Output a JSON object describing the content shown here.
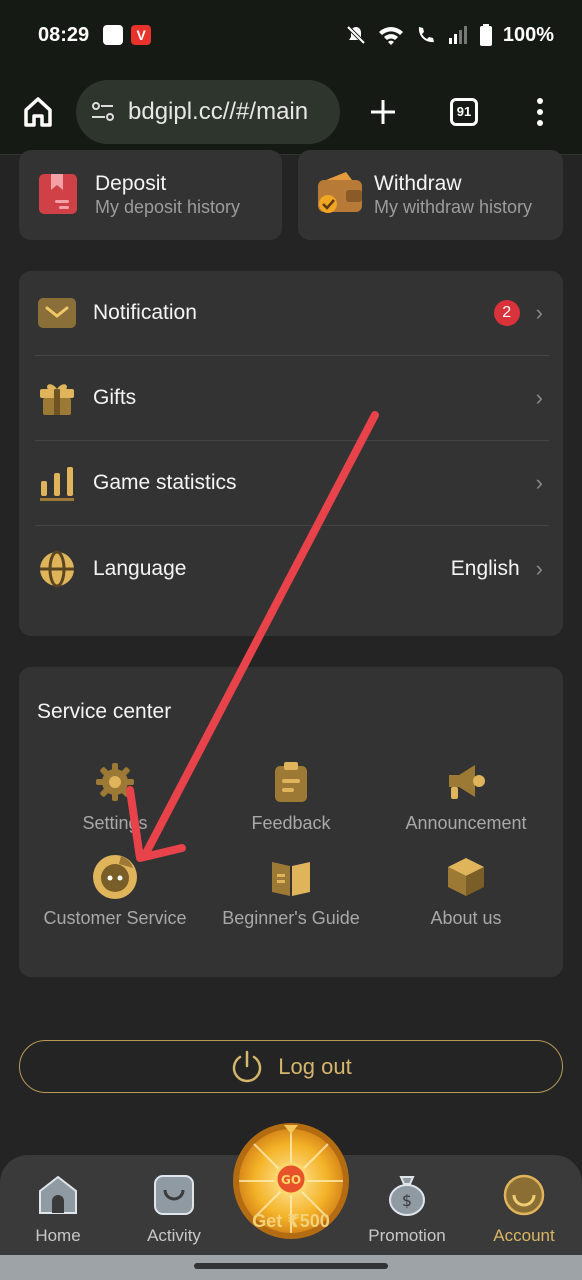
{
  "status_bar": {
    "time": "08:29",
    "battery": "100%",
    "app_icon_v": "V"
  },
  "browser": {
    "url": "bdgipl.cc//#/main",
    "tab_count": "91"
  },
  "wallet_cards": {
    "deposit": {
      "title": "Deposit",
      "subtitle": "My deposit history"
    },
    "withdraw": {
      "title": "Withdraw",
      "subtitle": "My withdraw history"
    }
  },
  "menu": {
    "notification": {
      "label": "Notification",
      "badge": "2"
    },
    "gifts": {
      "label": "Gifts"
    },
    "game_statistics": {
      "label": "Game statistics"
    },
    "language": {
      "label": "Language",
      "value": "English"
    }
  },
  "service_center": {
    "title": "Service center",
    "items": [
      {
        "label": "Settings",
        "icon": "gear-icon"
      },
      {
        "label": "Feedback",
        "icon": "clipboard-icon"
      },
      {
        "label": "Announcement",
        "icon": "megaphone-icon"
      },
      {
        "label": "Customer Service",
        "icon": "chat-bubble-icon"
      },
      {
        "label": "Beginner's Guide",
        "icon": "book-icon"
      },
      {
        "label": "About us",
        "icon": "box-icon"
      }
    ]
  },
  "logout": {
    "label": "Log out"
  },
  "bottom_nav": {
    "home": "Home",
    "activity": "Activity",
    "spin": {
      "go": "GO",
      "label": "Get ₹500"
    },
    "promotion": "Promotion",
    "account": "Account"
  },
  "colors": {
    "accent": "#d9b564",
    "card": "#333333",
    "background": "#242424",
    "badge": "#d8323b",
    "annotation_arrow": "#e8424a"
  }
}
